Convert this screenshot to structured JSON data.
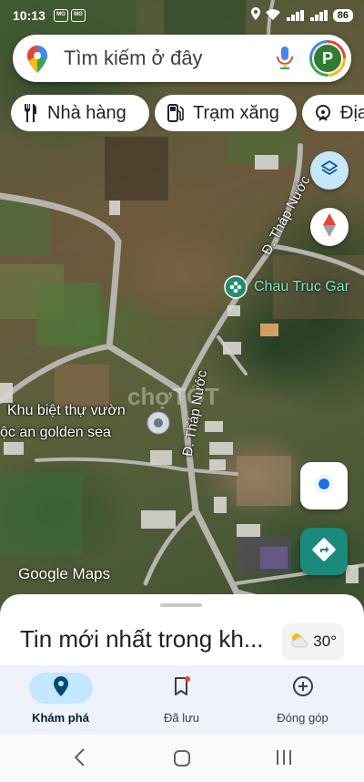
{
  "status_bar": {
    "time": "10:13",
    "battery": "86"
  },
  "search": {
    "placeholder": "Tìm kiếm ở đây",
    "avatar_letter": "P"
  },
  "chips": [
    {
      "label": "Nhà hàng",
      "icon": "fork-knife-icon"
    },
    {
      "label": "Trạm xăng",
      "icon": "gas-pump-icon"
    },
    {
      "label": "Địa",
      "icon": "attraction-icon"
    }
  ],
  "map": {
    "place_label_line1": "Khu biệt thự vườn",
    "place_label_line2": "ộc an golden sea",
    "poi_label": "Chau Truc Gar",
    "road_label_1": "Đ. Tháp Nước",
    "road_label_2": "Đ. Tháp Nước",
    "watermark": "chợTỐT",
    "attribution": "Google Maps"
  },
  "sheet": {
    "title": "Tin mới nhất trong kh...",
    "temperature": "30°"
  },
  "bottom_nav": [
    {
      "label": "Khám phá",
      "active": true
    },
    {
      "label": "Đã lưu",
      "active": false
    },
    {
      "label": "Đóng góp",
      "active": false
    }
  ],
  "colors": {
    "accent_blue": "#1a73e8",
    "teal": "#1a8a7d",
    "active_pill": "#c2e7ff"
  }
}
